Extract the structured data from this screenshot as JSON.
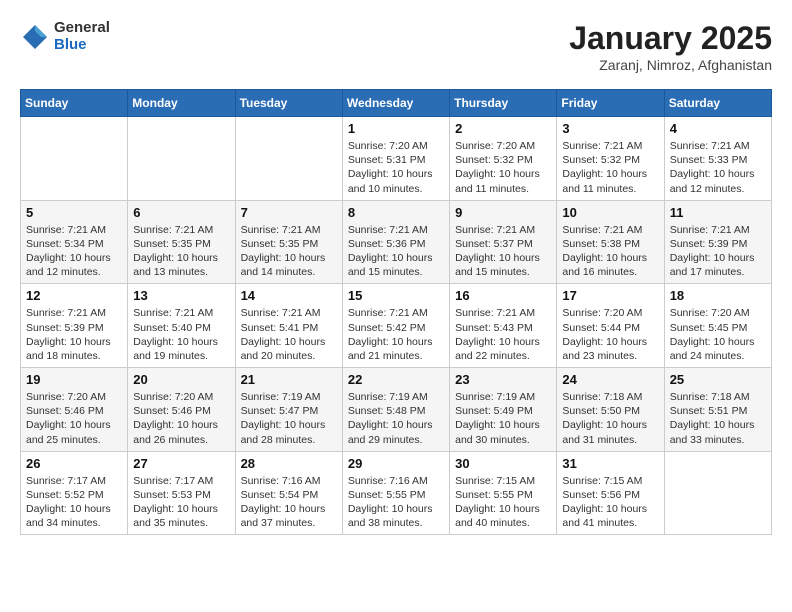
{
  "logo": {
    "general": "General",
    "blue": "Blue"
  },
  "header": {
    "month": "January 2025",
    "location": "Zaranj, Nimroz, Afghanistan"
  },
  "weekdays": [
    "Sunday",
    "Monday",
    "Tuesday",
    "Wednesday",
    "Thursday",
    "Friday",
    "Saturday"
  ],
  "weeks": [
    [
      {
        "day": "",
        "info": ""
      },
      {
        "day": "",
        "info": ""
      },
      {
        "day": "",
        "info": ""
      },
      {
        "day": "1",
        "info": "Sunrise: 7:20 AM\nSunset: 5:31 PM\nDaylight: 10 hours\nand 10 minutes."
      },
      {
        "day": "2",
        "info": "Sunrise: 7:20 AM\nSunset: 5:32 PM\nDaylight: 10 hours\nand 11 minutes."
      },
      {
        "day": "3",
        "info": "Sunrise: 7:21 AM\nSunset: 5:32 PM\nDaylight: 10 hours\nand 11 minutes."
      },
      {
        "day": "4",
        "info": "Sunrise: 7:21 AM\nSunset: 5:33 PM\nDaylight: 10 hours\nand 12 minutes."
      }
    ],
    [
      {
        "day": "5",
        "info": "Sunrise: 7:21 AM\nSunset: 5:34 PM\nDaylight: 10 hours\nand 12 minutes."
      },
      {
        "day": "6",
        "info": "Sunrise: 7:21 AM\nSunset: 5:35 PM\nDaylight: 10 hours\nand 13 minutes."
      },
      {
        "day": "7",
        "info": "Sunrise: 7:21 AM\nSunset: 5:35 PM\nDaylight: 10 hours\nand 14 minutes."
      },
      {
        "day": "8",
        "info": "Sunrise: 7:21 AM\nSunset: 5:36 PM\nDaylight: 10 hours\nand 15 minutes."
      },
      {
        "day": "9",
        "info": "Sunrise: 7:21 AM\nSunset: 5:37 PM\nDaylight: 10 hours\nand 15 minutes."
      },
      {
        "day": "10",
        "info": "Sunrise: 7:21 AM\nSunset: 5:38 PM\nDaylight: 10 hours\nand 16 minutes."
      },
      {
        "day": "11",
        "info": "Sunrise: 7:21 AM\nSunset: 5:39 PM\nDaylight: 10 hours\nand 17 minutes."
      }
    ],
    [
      {
        "day": "12",
        "info": "Sunrise: 7:21 AM\nSunset: 5:39 PM\nDaylight: 10 hours\nand 18 minutes."
      },
      {
        "day": "13",
        "info": "Sunrise: 7:21 AM\nSunset: 5:40 PM\nDaylight: 10 hours\nand 19 minutes."
      },
      {
        "day": "14",
        "info": "Sunrise: 7:21 AM\nSunset: 5:41 PM\nDaylight: 10 hours\nand 20 minutes."
      },
      {
        "day": "15",
        "info": "Sunrise: 7:21 AM\nSunset: 5:42 PM\nDaylight: 10 hours\nand 21 minutes."
      },
      {
        "day": "16",
        "info": "Sunrise: 7:21 AM\nSunset: 5:43 PM\nDaylight: 10 hours\nand 22 minutes."
      },
      {
        "day": "17",
        "info": "Sunrise: 7:20 AM\nSunset: 5:44 PM\nDaylight: 10 hours\nand 23 minutes."
      },
      {
        "day": "18",
        "info": "Sunrise: 7:20 AM\nSunset: 5:45 PM\nDaylight: 10 hours\nand 24 minutes."
      }
    ],
    [
      {
        "day": "19",
        "info": "Sunrise: 7:20 AM\nSunset: 5:46 PM\nDaylight: 10 hours\nand 25 minutes."
      },
      {
        "day": "20",
        "info": "Sunrise: 7:20 AM\nSunset: 5:46 PM\nDaylight: 10 hours\nand 26 minutes."
      },
      {
        "day": "21",
        "info": "Sunrise: 7:19 AM\nSunset: 5:47 PM\nDaylight: 10 hours\nand 28 minutes."
      },
      {
        "day": "22",
        "info": "Sunrise: 7:19 AM\nSunset: 5:48 PM\nDaylight: 10 hours\nand 29 minutes."
      },
      {
        "day": "23",
        "info": "Sunrise: 7:19 AM\nSunset: 5:49 PM\nDaylight: 10 hours\nand 30 minutes."
      },
      {
        "day": "24",
        "info": "Sunrise: 7:18 AM\nSunset: 5:50 PM\nDaylight: 10 hours\nand 31 minutes."
      },
      {
        "day": "25",
        "info": "Sunrise: 7:18 AM\nSunset: 5:51 PM\nDaylight: 10 hours\nand 33 minutes."
      }
    ],
    [
      {
        "day": "26",
        "info": "Sunrise: 7:17 AM\nSunset: 5:52 PM\nDaylight: 10 hours\nand 34 minutes."
      },
      {
        "day": "27",
        "info": "Sunrise: 7:17 AM\nSunset: 5:53 PM\nDaylight: 10 hours\nand 35 minutes."
      },
      {
        "day": "28",
        "info": "Sunrise: 7:16 AM\nSunset: 5:54 PM\nDaylight: 10 hours\nand 37 minutes."
      },
      {
        "day": "29",
        "info": "Sunrise: 7:16 AM\nSunset: 5:55 PM\nDaylight: 10 hours\nand 38 minutes."
      },
      {
        "day": "30",
        "info": "Sunrise: 7:15 AM\nSunset: 5:55 PM\nDaylight: 10 hours\nand 40 minutes."
      },
      {
        "day": "31",
        "info": "Sunrise: 7:15 AM\nSunset: 5:56 PM\nDaylight: 10 hours\nand 41 minutes."
      },
      {
        "day": "",
        "info": ""
      }
    ]
  ]
}
